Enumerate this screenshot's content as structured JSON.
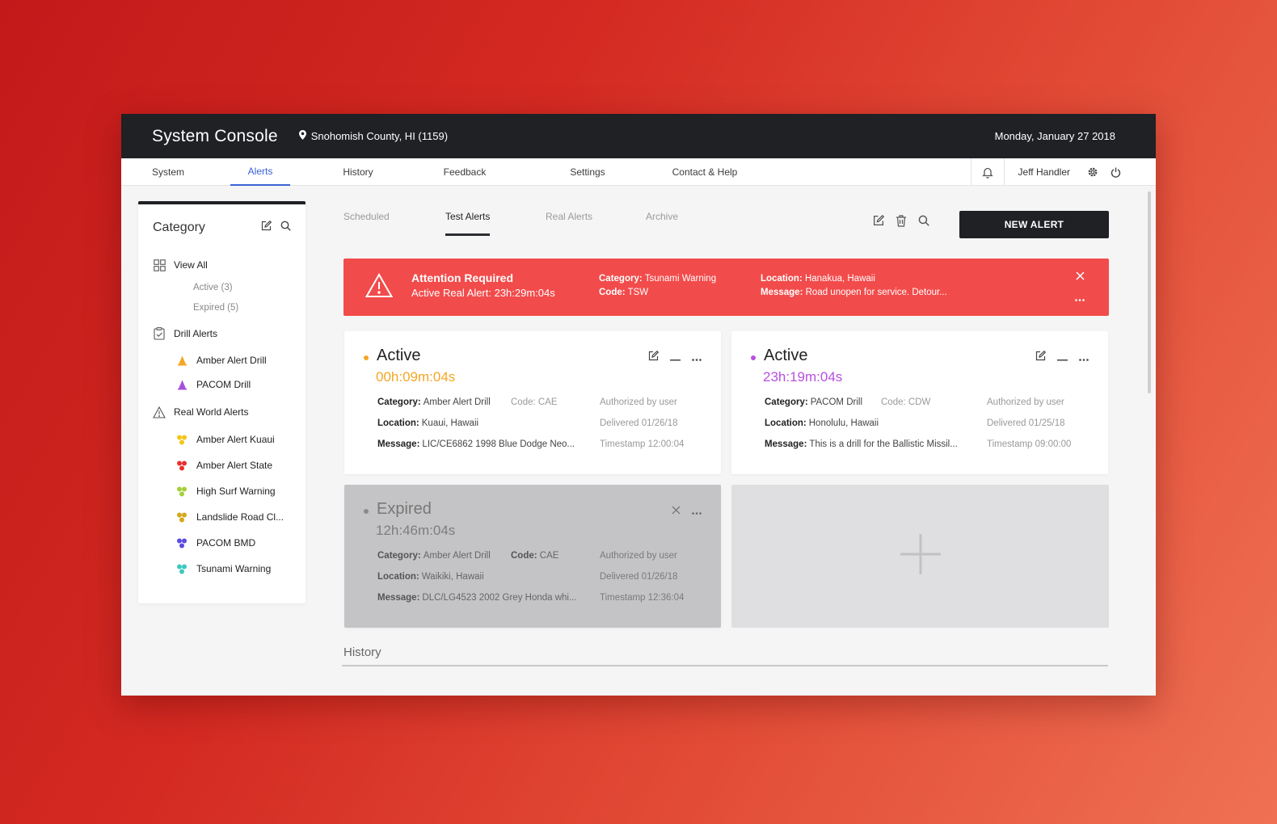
{
  "header": {
    "title": "System Console",
    "location": "Snohomish County, HI (1159)",
    "date": "Monday, January 27 2018"
  },
  "nav": {
    "tabs": [
      "System",
      "Alerts",
      "History",
      "Feedback",
      "Settings",
      "Contact & Help"
    ],
    "active_tab": "Alerts",
    "user": "Jeff Handler"
  },
  "sidebar": {
    "title": "Category",
    "view_all": "View All",
    "active": "Active (3)",
    "expired": "Expired (5)",
    "drill_group": "Drill Alerts",
    "drill_items": [
      {
        "label": "Amber Alert Drill",
        "color": "#f5a623"
      },
      {
        "label": "PACOM Drill",
        "color": "#a64fe0"
      }
    ],
    "real_group": "Real World Alerts",
    "real_items": [
      {
        "label": "Amber Alert Kuaui",
        "color": "#f5c518"
      },
      {
        "label": "Amber Alert State",
        "color": "#e8312f"
      },
      {
        "label": "High Surf Warning",
        "color": "#a6cf3a"
      },
      {
        "label": "Landslide Road Cl...",
        "color": "#d4a81c"
      },
      {
        "label": "PACOM BMD",
        "color": "#5b4be0"
      },
      {
        "label": "Tsunami Warning",
        "color": "#3ec7c0"
      }
    ]
  },
  "subtabs": [
    "Scheduled",
    "Test Alerts",
    "Real Alerts",
    "Archive"
  ],
  "active_subtab": "Test Alerts",
  "new_alert_label": "NEW ALERT",
  "banner": {
    "title": "Attention Required",
    "subtitle": "Active Real Alert:  23h:29m:04s",
    "category_label": "Category:",
    "category": "Tsunami Warning",
    "code_label": "Code:",
    "code": "TSW",
    "location_label": "Location:",
    "location": "Hanakua, Hawaii",
    "message_label": "Message:",
    "message": "Road unopen for service. Detour..."
  },
  "cards": [
    {
      "status": "Active",
      "timer": "00h:09m:04s",
      "accent": "#f5a623",
      "category_label": "Category:",
      "category": "Amber Alert Drill",
      "code_label": "Code:",
      "code": "CAE",
      "location_label": "Location:",
      "location": "Kuaui, Hawaii",
      "message_label": "Message:",
      "message": "LIC/CE6862 1998 Blue Dodge Neo...",
      "authorized": "Authorized by user",
      "delivered": "Delivered 01/26/18",
      "timestamp": "Timestamp 12:00:04"
    },
    {
      "status": "Active",
      "timer": "23h:19m:04s",
      "accent": "#b84fe0",
      "category_label": "Category:",
      "category": "PACOM Drill",
      "code_label": "Code:",
      "code": "CDW",
      "location_label": "Location:",
      "location": "Honolulu, Hawaii",
      "message_label": "Message:",
      "message": "This is a drill for the Ballistic Missil...",
      "authorized": "Authorized by user",
      "delivered": "Delivered 01/25/18",
      "timestamp": "Timestamp 09:00:00"
    },
    {
      "status": "Expired",
      "timer": "12h:46m:04s",
      "accent": "#8a8a8a",
      "category_label": "Category:",
      "category": "Amber Alert Drill",
      "code_label": "Code:",
      "code": "CAE",
      "location_label": "Location:",
      "location": "Waikiki, Hawaii",
      "message_label": "Message:",
      "message": "DLC/LG4523 2002 Grey Honda whi...",
      "authorized": "Authorized by user",
      "delivered": "Delivered 01/26/18",
      "timestamp": "Timestamp 12:36:04"
    }
  ],
  "history_title": "History"
}
